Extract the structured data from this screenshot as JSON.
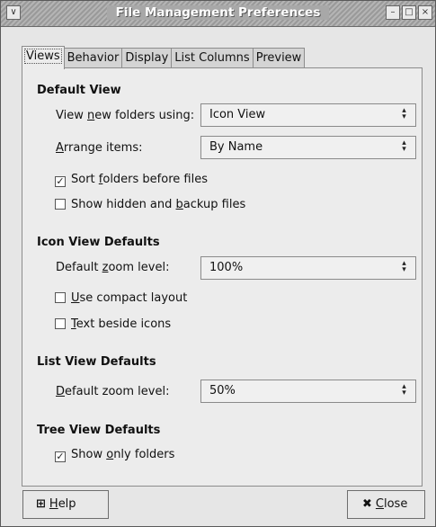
{
  "window": {
    "title": "File Management Preferences",
    "menu_glyph": "∨",
    "minimize_glyph": "–",
    "maximize_glyph": "□",
    "close_glyph": "×"
  },
  "tabs": [
    {
      "label": "Views",
      "active": true
    },
    {
      "label": "Behavior",
      "active": false
    },
    {
      "label": "Display",
      "active": false
    },
    {
      "label": "List Columns",
      "active": false
    },
    {
      "label": "Preview",
      "active": false
    }
  ],
  "default_view": {
    "heading": "Default View",
    "view_new_folders_label": {
      "pre": "View ",
      "u": "n",
      "post": "ew folders using:"
    },
    "view_new_folders_value": "Icon View",
    "arrange_label": {
      "pre": "",
      "u": "A",
      "post": "rrange items:"
    },
    "arrange_value": "By Name",
    "sort_folders": {
      "pre": "Sort ",
      "u": "f",
      "post": "olders before files",
      "checked": true
    },
    "show_hidden": {
      "pre": "Show hidden and ",
      "u": "b",
      "post": "ackup files",
      "checked": false
    }
  },
  "icon_view": {
    "heading": "Icon View Defaults",
    "zoom_label": {
      "pre": "Default ",
      "u": "z",
      "post": "oom level:"
    },
    "zoom_value": "100%",
    "compact": {
      "pre": "",
      "u": "U",
      "post": "se compact layout",
      "checked": false
    },
    "text_beside": {
      "pre": "",
      "u": "T",
      "post": "ext beside icons",
      "checked": false
    }
  },
  "list_view": {
    "heading": "List View Defaults",
    "zoom_label": {
      "pre": "",
      "u": "D",
      "post": "efault zoom level:"
    },
    "zoom_value": "50%"
  },
  "tree_view": {
    "heading": "Tree View Defaults",
    "only_folders": {
      "pre": "Show ",
      "u": "o",
      "post": "nly folders",
      "checked": true
    }
  },
  "buttons": {
    "help": {
      "pre": "",
      "u": "H",
      "post": "elp"
    },
    "close": {
      "pre": "",
      "u": "C",
      "post": "lose"
    }
  },
  "glyphs": {
    "check": "✓",
    "combo_arrow": "▴▾",
    "help_icon": "⊞",
    "close_icon": "✖"
  }
}
